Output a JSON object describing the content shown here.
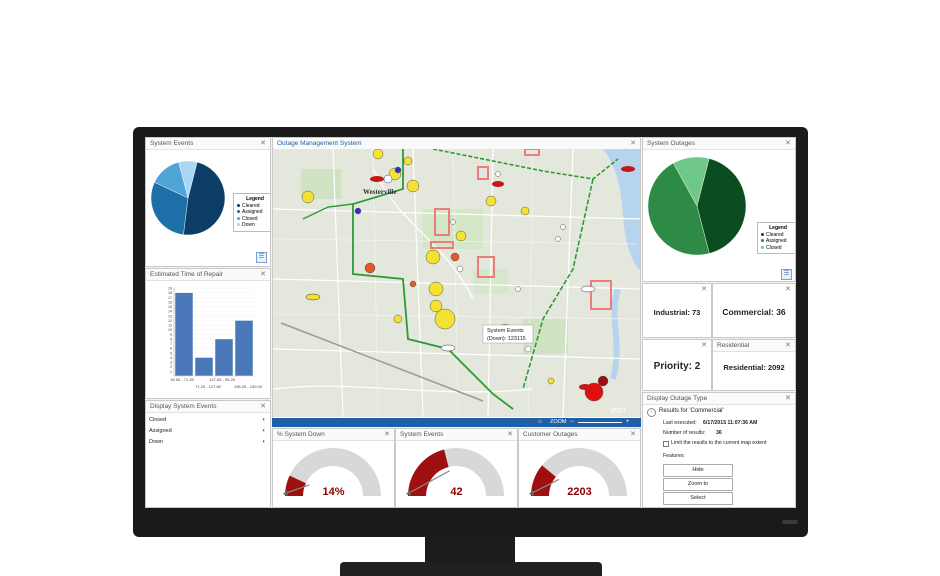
{
  "panels": {
    "system_events": {
      "title": "System Events"
    },
    "repair_time": {
      "title": "Estimated Time of Repair"
    },
    "display_events": {
      "title": "Display System Events"
    },
    "map": {
      "title": "Outage Management System"
    },
    "outages": {
      "title": "System Outages"
    },
    "residential": {
      "title": "Residential"
    },
    "display_outage_type": {
      "title": "Display Outage Type"
    },
    "pct_down": {
      "title": "% System Down"
    },
    "sys_events_gauge": {
      "title": "System Events"
    },
    "cust_outages": {
      "title": "Customer Outages"
    }
  },
  "legend": {
    "title": "Legend"
  },
  "events_legend": [
    {
      "label": "Cleared",
      "color": "#0b3d66"
    },
    {
      "label": "Assigned",
      "color": "#1d6fa8"
    },
    {
      "label": "Closed",
      "color": "#4fa3d6"
    },
    {
      "label": "Down",
      "color": "#a9d6f2"
    }
  ],
  "outages_legend": [
    {
      "label": "Cleared",
      "color": "#0b4d1e"
    },
    {
      "label": "Assigned",
      "color": "#2e8b46"
    },
    {
      "label": "Closed",
      "color": "#6fc889"
    }
  ],
  "display_list": [
    {
      "label": "Closed"
    },
    {
      "label": "Assigned"
    },
    {
      "label": "Down"
    }
  ],
  "stats": {
    "industrial": "Industrial: 73",
    "commercial": "Commercial: 36",
    "priority": "Priority: 2",
    "residential": "Residential: 2092"
  },
  "gauges": {
    "pct_down": "14%",
    "events": "42",
    "customers": "2203"
  },
  "map": {
    "town_label": "Westerville",
    "popup_line1": "System Events",
    "popup_line2": "(Down): 123115",
    "zoom_label": "ZOOM",
    "attribution": "esri"
  },
  "results": {
    "heading": "Results for 'Commercial'",
    "last_executed_label": "Last executed:",
    "last_executed_value": "6/17/2015 11:07:36 AM",
    "count_label": "Number of results:",
    "count_value": "36",
    "limit_label": "Limit the results to the current map extent",
    "features_label": "Features:",
    "hide": "Hide",
    "zoom_to": "Zoom to",
    "select": "Select"
  },
  "chart_data": [
    {
      "type": "bar",
      "title": "Estimated Time of Repair",
      "categories": [
        "16.50 - 71.25",
        "71.25 - 127.60",
        "127.60 - 95.25",
        "195.25 - 240.00"
      ],
      "values": [
        18,
        4,
        8,
        12
      ],
      "ylim": [
        0,
        19
      ],
      "yticks": [
        1,
        2,
        3,
        4,
        5,
        6,
        7,
        8,
        9,
        10,
        11,
        12,
        13,
        14,
        15,
        16,
        17,
        18,
        19
      ],
      "color": "#4a78b8"
    },
    {
      "type": "pie",
      "title": "System Events",
      "labels": [
        "Cleared",
        "Assigned",
        "Closed",
        "Down"
      ],
      "values": [
        48,
        30,
        14,
        8
      ]
    },
    {
      "type": "pie",
      "title": "System Outages",
      "labels": [
        "Cleared",
        "Assigned",
        "Closed"
      ],
      "values": [
        42,
        46,
        12
      ]
    }
  ]
}
